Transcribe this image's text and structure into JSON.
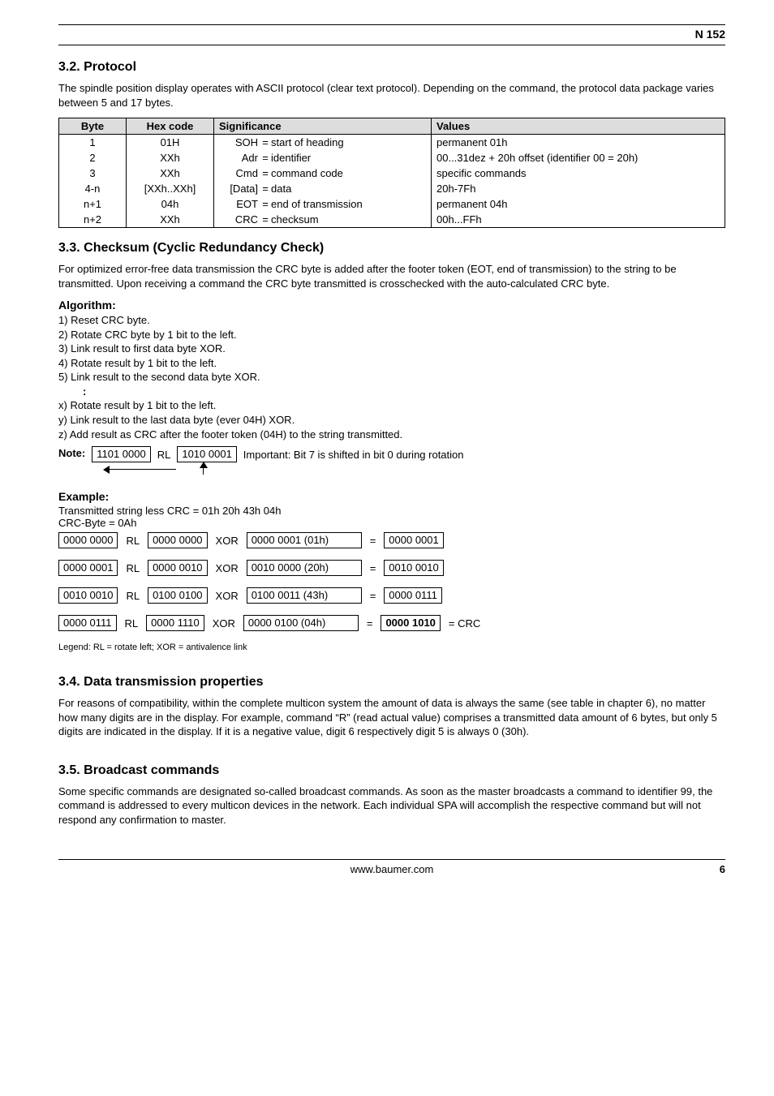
{
  "header": {
    "right": "N 152"
  },
  "sec32": {
    "title": "3.2.  Protocol",
    "para": "The spindle position display operates with ASCII protocol (clear text protocol). Depending on the command, the protocol data package varies between 5 and 17 bytes.",
    "cols": [
      "Byte",
      "Hex code",
      "Significance",
      "Values"
    ],
    "rows": [
      {
        "byte": "1",
        "hex": "01H",
        "sig_key": "SOH",
        "sig_eq": "=",
        "sig_txt": "start of heading",
        "val": "permanent 01h"
      },
      {
        "byte": "2",
        "hex": "XXh",
        "sig_key": "Adr",
        "sig_eq": "=",
        "sig_txt": "identifier",
        "val": "00...31dez + 20h offset  (identifier 00 = 20h)"
      },
      {
        "byte": "3",
        "hex": "XXh",
        "sig_key": "Cmd",
        "sig_eq": "=",
        "sig_txt": "command code",
        "val": "specific commands"
      },
      {
        "byte": "4-n",
        "hex": "[XXh..XXh]",
        "sig_key": "[Data]",
        "sig_eq": "=",
        "sig_txt": "data",
        "val": "20h-7Fh"
      },
      {
        "byte": "n+1",
        "hex": "04h",
        "sig_key": "EOT",
        "sig_eq": "=",
        "sig_txt": "end of transmission",
        "val": "permanent 04h"
      },
      {
        "byte": "n+2",
        "hex": "XXh",
        "sig_key": "CRC",
        "sig_eq": "=",
        "sig_txt": "checksum",
        "val": "00h...FFh"
      }
    ]
  },
  "sec33": {
    "title": "3.3.  Checksum (Cyclic Redundancy Check)",
    "para": "For optimized error-free data transmission the CRC byte is added after the footer token (EOT, end of transmission) to the string to be transmitted. Upon receiving a command the CRC byte transmitted is crosschecked with the auto-calculated CRC byte.",
    "algoTitle": "Algorithm:",
    "algo": [
      "1) Reset CRC byte.",
      "2) Rotate CRC byte by 1 bit to the left.",
      "3) Link result to first data byte XOR.",
      "4) Rotate result by 1 bit to the left.",
      "5) Link result to the second data byte XOR."
    ],
    "algoTail": [
      "x) Rotate result by 1 bit to the left.",
      "y) Link result to the last data byte (ever 04H) XOR.",
      "z) Add result as CRC after the footer token (04H) to the string transmitted."
    ],
    "noteLabel": "Note:",
    "noteA": "1101 0000",
    "noteRL": "RL",
    "noteB": "1010 0001",
    "noteText": "Important: Bit 7 is shifted in bit 0 during rotation",
    "exampleTitle": "Example:",
    "exLine1": "Transmitted string less CRC =  01h 20h 43h 04h",
    "exLine2": "CRC-Byte       =   0Ah",
    "rows": [
      {
        "a": "0000 0000",
        "b": "0000 0000",
        "c": "0000 0001  (01h)",
        "r": "0000 0001",
        "crc": false
      },
      {
        "a": "0000 0001",
        "b": "0000 0010",
        "c": "0010 0000  (20h)",
        "r": "0010 0010",
        "crc": false
      },
      {
        "a": "0010 0010",
        "b": "0100 0100",
        "c": "0100 0011  (43h)",
        "r": "0000 0111",
        "crc": false
      },
      {
        "a": "0000 0111",
        "b": "0000 1110",
        "c": "0000 0100  (04h)",
        "r": "0000 1010",
        "crc": true
      }
    ],
    "rlLabel": "RL",
    "xorLabel": "XOR",
    "eqLabel": "=",
    "crcLabel": "=   CRC",
    "legend": "Legend:  RL = rotate left;   XOR = antivalence link"
  },
  "sec34": {
    "title": "3.4.  Data transmission properties",
    "para": "For reasons of compatibility, within the complete multicon system the amount of data is always the same (see table in chapter 6), no matter how many digits are in the display. For example, command “R” (read actual value) comprises a transmitted data amount of 6 bytes, but only 5 digits are indicated in the display. If it is a negative value, digit 6 respectively digit 5 is always 0 (30h)."
  },
  "sec35": {
    "title": "3.5.  Broadcast commands",
    "para": "Some specific commands are designated so-called broadcast commands. As soon as the master broadcasts a command to identifier 99, the command is addressed to every multicon devices in the network. Each individual SPA will accomplish the respective command but will not respond any confirmation to master."
  },
  "footer": {
    "center": "www.baumer.com",
    "pageNum": "6"
  }
}
